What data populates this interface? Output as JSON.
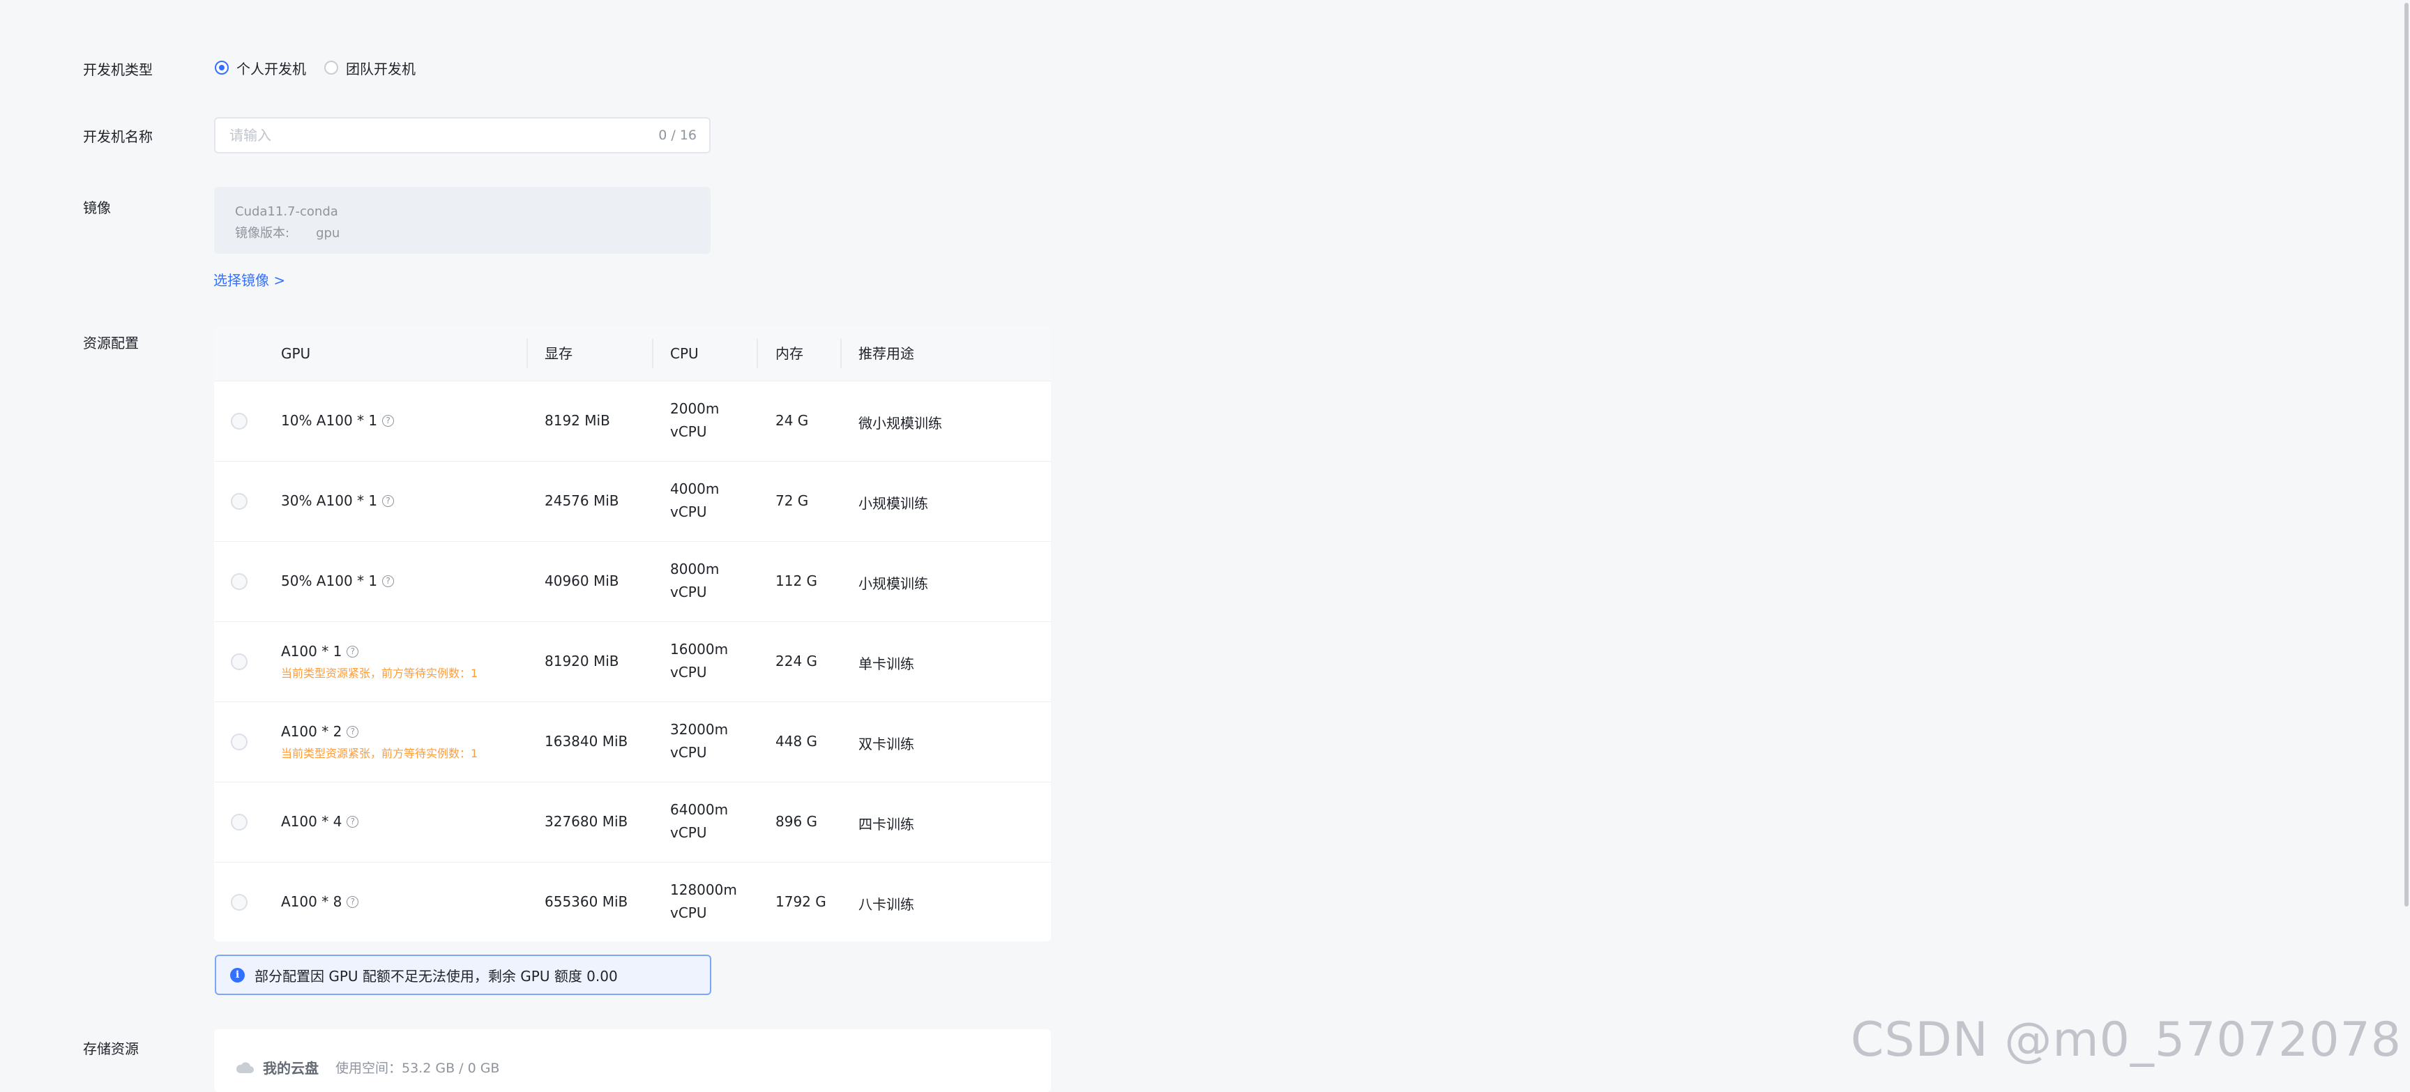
{
  "form": {
    "type_label": "开发机类型",
    "type_options": [
      {
        "label": "个人开发机",
        "selected": true
      },
      {
        "label": "团队开发机",
        "selected": false
      }
    ],
    "name_label": "开发机名称",
    "name_placeholder": "请输入",
    "name_value": "",
    "name_count": "0 / 16",
    "image_label": "镜像",
    "image_name": "Cuda11.7-conda",
    "image_version_label": "镜像版本:",
    "image_version_value": "gpu",
    "select_image_link": "选择镜像 >",
    "resource_label": "资源配置",
    "storage_label": "存储资源"
  },
  "resource_table": {
    "headers": {
      "gpu": "GPU",
      "vram": "显存",
      "cpu": "CPU",
      "memory": "内存",
      "usage": "推荐用途"
    },
    "rows": [
      {
        "gpu": "10% A100 * 1",
        "warning": "",
        "vram": "8192 MiB",
        "cpu_value": "2000m",
        "cpu_unit": "vCPU",
        "memory": "24 G",
        "usage": "微小规模训练"
      },
      {
        "gpu": "30% A100 * 1",
        "warning": "",
        "vram": "24576 MiB",
        "cpu_value": "4000m",
        "cpu_unit": "vCPU",
        "memory": "72 G",
        "usage": "小规模训练"
      },
      {
        "gpu": "50% A100 * 1",
        "warning": "",
        "vram": "40960 MiB",
        "cpu_value": "8000m",
        "cpu_unit": "vCPU",
        "memory": "112 G",
        "usage": "小规模训练"
      },
      {
        "gpu": "A100 * 1",
        "warning": "当前类型资源紧张，前方等待实例数：1",
        "vram": "81920 MiB",
        "cpu_value": "16000m",
        "cpu_unit": "vCPU",
        "memory": "224 G",
        "usage": "单卡训练"
      },
      {
        "gpu": "A100 * 2",
        "warning": "当前类型资源紧张，前方等待实例数：1",
        "vram": "163840 MiB",
        "cpu_value": "32000m",
        "cpu_unit": "vCPU",
        "memory": "448 G",
        "usage": "双卡训练"
      },
      {
        "gpu": "A100 * 4",
        "warning": "",
        "vram": "327680 MiB",
        "cpu_value": "64000m",
        "cpu_unit": "vCPU",
        "memory": "896 G",
        "usage": "四卡训练"
      },
      {
        "gpu": "A100 * 8",
        "warning": "",
        "vram": "655360 MiB",
        "cpu_value": "128000m",
        "cpu_unit": "vCPU",
        "memory": "1792 G",
        "usage": "八卡训练"
      }
    ]
  },
  "alert": {
    "text": "部分配置因 GPU 配额不足无法使用，剩余 GPU 额度 0.00",
    "icon": "info-icon"
  },
  "storage": {
    "title": "我的云盘",
    "used": "使用空间：53.2 GB / 0 GB",
    "icon": "cloud-icon"
  },
  "watermark": "CSDN @m0_57072078",
  "colors": {
    "accent": "#3370ff",
    "warning": "#ff9c38",
    "background": "#f6f7f9"
  }
}
